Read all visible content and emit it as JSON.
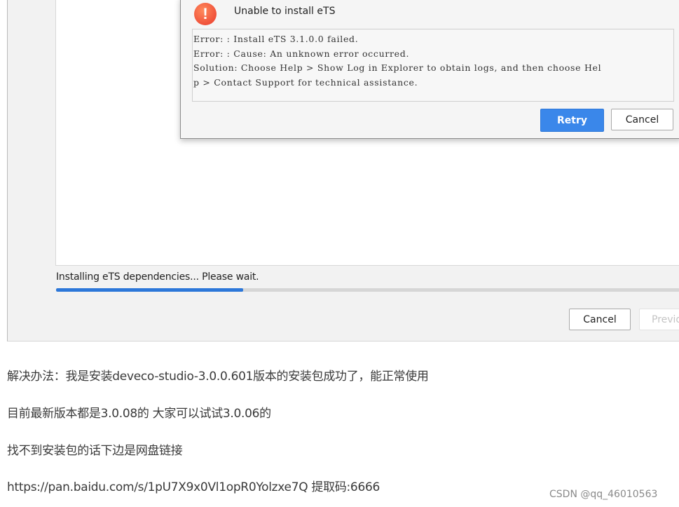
{
  "dialog": {
    "title": "Unable to install eTS",
    "icon": "warning-icon",
    "icon_color": "#f0513a",
    "error_lines": [
      "Error: : Install eTS 3.1.0.0 failed.",
      "Error: : Cause: An unknown error occurred.",
      "Solution: Choose Help > Show Log in Explorer to obtain logs, and then choose Hel",
      "p > Contact Support for technical assistance."
    ],
    "retry_label": "Retry",
    "cancel_label": "Cancel",
    "accent_color": "#3a87ea"
  },
  "installer": {
    "status_text": "Installing eTS dependencies... Please wait.",
    "progress_fraction": 0.3,
    "cancel_label": "Cancel",
    "previous_label": "Previous"
  },
  "article": {
    "paragraphs": [
      "解决办法：我是安装deveco-studio-3.0.0.601版本的安装包成功了，能正常使用",
      "目前最新版本都是3.0.08的 大家可以试试3.0.06的",
      "找不到安装包的话下边是网盘链接",
      "https://pan.baidu.com/s/1pU7X9x0Vl1opR0Yolzxe7Q 提取码:6666"
    ],
    "watermark": "CSDN @qq_46010563"
  }
}
